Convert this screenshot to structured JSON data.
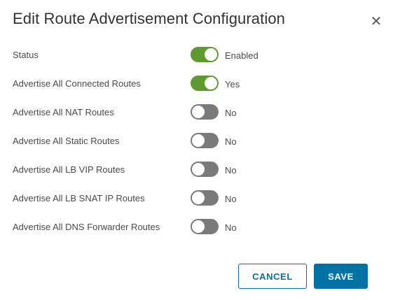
{
  "dialog": {
    "title": "Edit Route Advertisement Configuration",
    "close_icon": "close-icon"
  },
  "rows": [
    {
      "label": "Status",
      "value": "Enabled",
      "enabled": true
    },
    {
      "label": "Advertise All Connected Routes",
      "value": "Yes",
      "enabled": true
    },
    {
      "label": "Advertise All NAT Routes",
      "value": "No",
      "enabled": false
    },
    {
      "label": "Advertise All Static Routes",
      "value": "No",
      "enabled": false
    },
    {
      "label": "Advertise All LB VIP Routes",
      "value": "No",
      "enabled": false
    },
    {
      "label": "Advertise All LB SNAT IP Routes",
      "value": "No",
      "enabled": false
    },
    {
      "label": "Advertise All DNS Forwarder Routes",
      "value": "No",
      "enabled": false
    }
  ],
  "footer": {
    "cancel_label": "CANCEL",
    "save_label": "SAVE"
  },
  "colors": {
    "toggle_on": "#5f9a30",
    "toggle_off": "#7a7a7a",
    "primary": "#0072a3"
  }
}
